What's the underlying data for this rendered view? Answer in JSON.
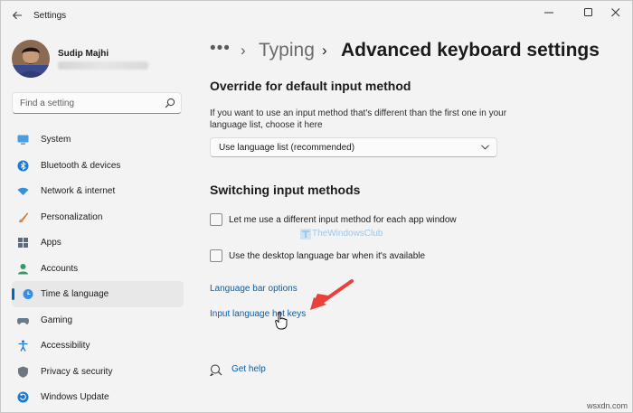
{
  "window": {
    "app_title": "Settings"
  },
  "user": {
    "name": "Sudip Majhi"
  },
  "search": {
    "placeholder": "Find a setting"
  },
  "sidebar": {
    "items": [
      {
        "label": "System",
        "icon": "monitor-icon",
        "selected": false
      },
      {
        "label": "Bluetooth & devices",
        "icon": "bluetooth-icon",
        "selected": false
      },
      {
        "label": "Network & internet",
        "icon": "wifi-icon",
        "selected": false
      },
      {
        "label": "Personalization",
        "icon": "brush-icon",
        "selected": false
      },
      {
        "label": "Apps",
        "icon": "apps-icon",
        "selected": false
      },
      {
        "label": "Accounts",
        "icon": "person-icon",
        "selected": false
      },
      {
        "label": "Time & language",
        "icon": "globe-clock-icon",
        "selected": true
      },
      {
        "label": "Gaming",
        "icon": "gamepad-icon",
        "selected": false
      },
      {
        "label": "Accessibility",
        "icon": "accessibility-icon",
        "selected": false
      },
      {
        "label": "Privacy & security",
        "icon": "shield-icon",
        "selected": false
      },
      {
        "label": "Windows Update",
        "icon": "update-icon",
        "selected": false
      }
    ]
  },
  "breadcrumb": {
    "more": "•••",
    "parent": "Typing",
    "current": "Advanced keyboard settings"
  },
  "override": {
    "title": "Override for default input method",
    "description": "If you want to use an input method that's different than the first one in your language list, choose it here",
    "dropdown_value": "Use language list (recommended)"
  },
  "switching": {
    "title": "Switching input methods",
    "checkbox_per_app": "Let me use a different input method for each app window",
    "checkbox_language_bar": "Use the desktop language bar when it's available"
  },
  "links": {
    "language_bar_options": "Language bar options",
    "input_language_hot_keys": "Input language hot keys",
    "get_help": "Get help"
  },
  "watermark": {
    "text": "TheWindowsClub"
  },
  "site_mark": "wsxdn.com",
  "colors": {
    "accent": "#0067c0",
    "link": "#005fb8",
    "annotation_arrow": "#e8413a"
  }
}
